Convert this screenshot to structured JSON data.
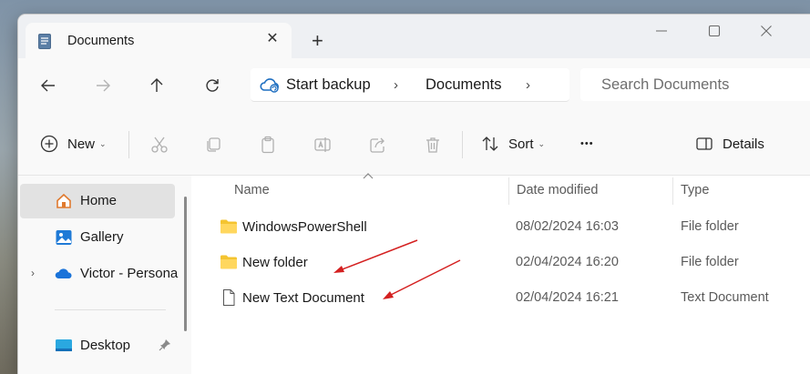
{
  "window": {
    "tab_title": "Documents",
    "tab_close": "✕",
    "new_tab": "+"
  },
  "navbar": {
    "breadcrumb": {
      "backup_label": "Start backup",
      "separator": "›",
      "folder": "Documents"
    },
    "search_placeholder": "Search Documents"
  },
  "toolbar": {
    "new_label": "New",
    "sort_label": "Sort",
    "caret": "⌄",
    "more": "•••",
    "details_label": "Details"
  },
  "sidebar": {
    "items": [
      {
        "label": "Home",
        "icon": "home-icon"
      },
      {
        "label": "Gallery",
        "icon": "gallery-icon"
      },
      {
        "label": "Victor - Persona",
        "icon": "onedrive-icon",
        "chevron": "›"
      },
      {
        "label": "Desktop",
        "icon": "desktop-icon"
      }
    ]
  },
  "columns": {
    "name": "Name",
    "date": "Date modified",
    "type": "Type"
  },
  "files": [
    {
      "name": "WindowsPowerShell",
      "date": "08/02/2024 16:03",
      "type": "File folder",
      "icon": "folder-icon"
    },
    {
      "name": "New folder",
      "date": "02/04/2024 16:20",
      "type": "File folder",
      "icon": "folder-icon"
    },
    {
      "name": "New Text Document",
      "date": "02/04/2024 16:21",
      "type": "Text Document",
      "icon": "text-document-icon"
    }
  ],
  "colors": {
    "accent": "#0067c0",
    "folder": "#f4c430",
    "annotation_arrow": "#d42020"
  }
}
